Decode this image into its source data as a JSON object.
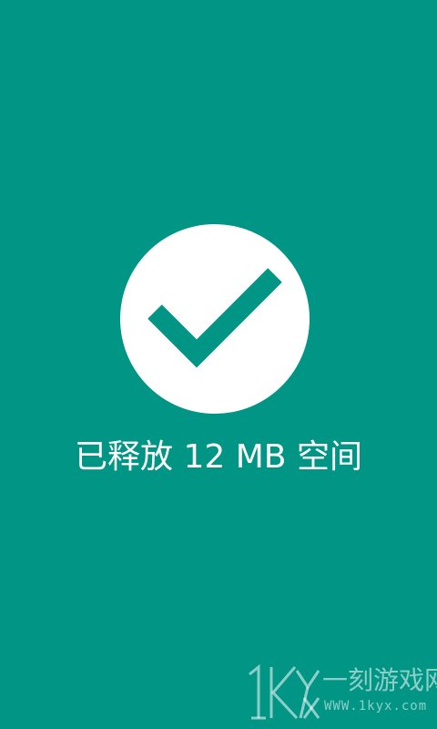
{
  "screen": {
    "background_color": "#009585",
    "status_message": "已释放 12 MB 空间"
  },
  "icon": {
    "name": "checkmark-icon",
    "circle_color": "#ffffff",
    "check_color": "#009585"
  },
  "watermark": {
    "name": "一刻游戏网",
    "url": "WWW.1kyx.com",
    "logo_text": "1Kyx"
  }
}
